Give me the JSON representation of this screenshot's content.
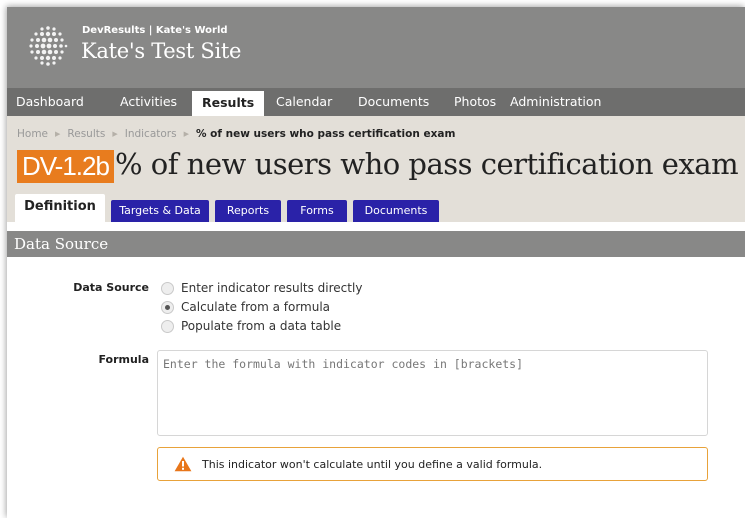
{
  "header": {
    "org": "DevResults | Kate's World",
    "site": "Kate's Test Site"
  },
  "nav": {
    "items": [
      "Dashboard",
      "Activities",
      "Results",
      "Calendar",
      "Documents",
      "Photos",
      "Administration"
    ],
    "active": "Results"
  },
  "breadcrumb": {
    "items": [
      "Home",
      "Results",
      "Indicators",
      "% of new users who pass certification exam"
    ]
  },
  "page": {
    "code": "DV-1.2b",
    "title": "% of new users who pass certification exam"
  },
  "tabs": {
    "items": [
      "Definition",
      "Targets & Data",
      "Reports",
      "Forms",
      "Documents"
    ],
    "active": "Definition"
  },
  "section": {
    "title": "Data Source"
  },
  "data_source": {
    "label": "Data Source",
    "options": [
      "Enter indicator results directly",
      "Calculate from a formula",
      "Populate from a data table"
    ],
    "selected": "Calculate from a formula"
  },
  "formula": {
    "label": "Formula",
    "placeholder": "Enter the formula with indicator codes in [brackets]",
    "value": ""
  },
  "warning": {
    "text": "This indicator won't calculate until you define a valid formula."
  },
  "colors": {
    "accent_orange": "#e87c1e",
    "tab_blue": "#2a22a8",
    "header_gray": "#888887",
    "nav_gray": "#6e6e6d",
    "band_beige": "#e3dfd8"
  }
}
